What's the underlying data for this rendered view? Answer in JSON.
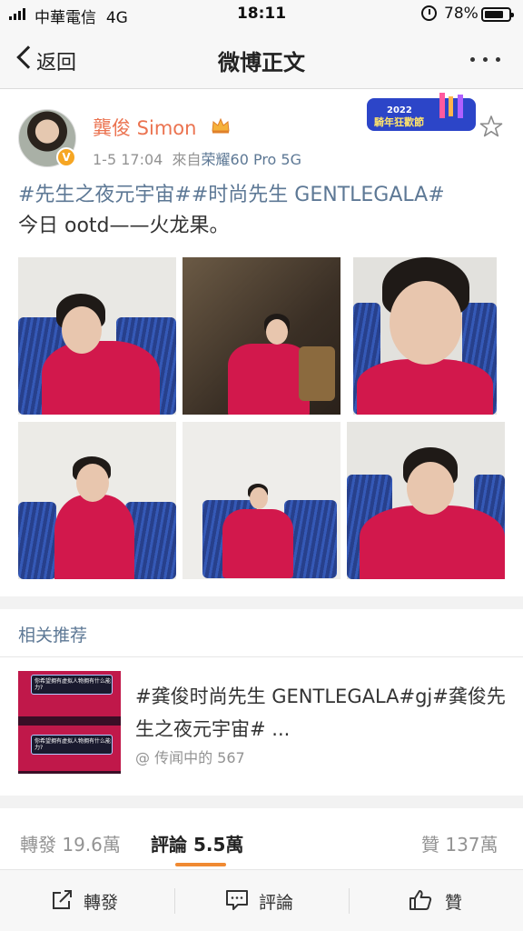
{
  "status_bar": {
    "carrier": "中華電信",
    "network": "4G",
    "time": "18:11",
    "battery": "78%",
    "battery_level": 0.78
  },
  "nav": {
    "back_label": "返回",
    "title": "微博正文"
  },
  "post": {
    "author": "龔俊 Simon",
    "time": "1-5 17:04",
    "source_prefix": "來自",
    "device": "荣耀60 Pro 5G",
    "hashtags": "#先生之夜元宇宙##时尚先生 GENTLEGALA#",
    "body": "今日 ootd——火龙果。",
    "badge_year": "2022",
    "badge_text": "騎年狂歡節"
  },
  "related": {
    "heading": "相关推荐",
    "title": "#龚俊时尚先生 GENTLEGALA#gj#龚俊先生之夜元宇宙# ...",
    "author": "@ 传闻中的 567",
    "thumb_caption_1": "你希望拥有虚拟人物拥有什么能力?",
    "thumb_caption_2": "你希望拥有虚拟人物拥有什么能力?"
  },
  "stats": {
    "repost": "轉發 19.6萬",
    "comment": "評論 5.5萬",
    "like": "贊 137萬"
  },
  "toolbar": {
    "repost": "轉發",
    "comment": "評論",
    "like": "贊"
  },
  "colors": {
    "accent_orange": "#eb7350",
    "link_blue": "#5d7895",
    "underline": "#f08a32"
  }
}
